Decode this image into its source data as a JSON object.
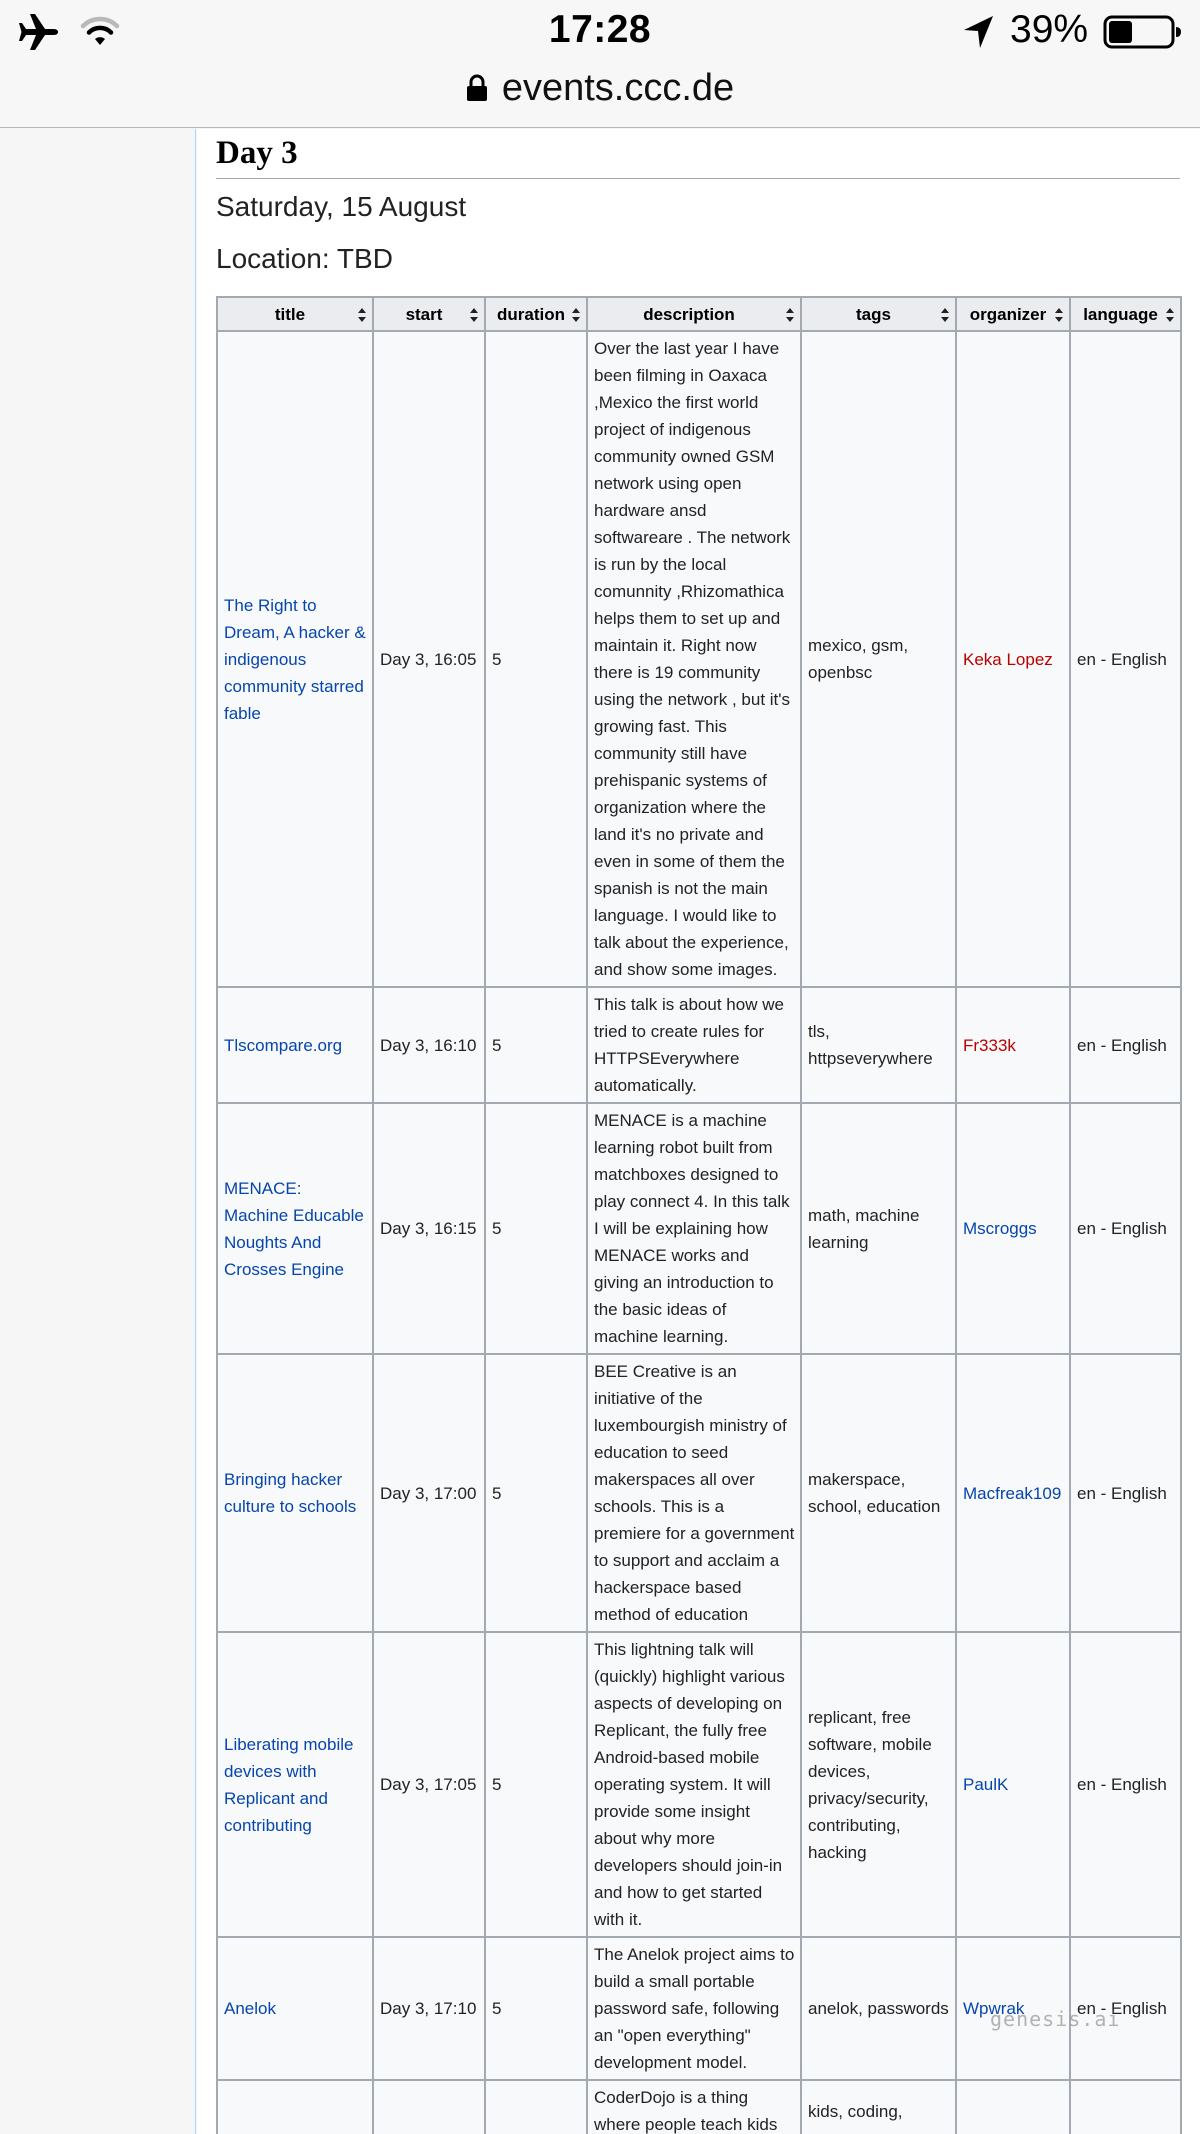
{
  "status_bar": {
    "time": "17:28",
    "battery_percent": "39%",
    "battery_level": 0.39,
    "url": "events.ccc.de"
  },
  "page": {
    "day_heading": "Day 3",
    "date": "Saturday, 15 August",
    "location": "Location: TBD"
  },
  "table": {
    "headers": [
      "title",
      "start",
      "duration",
      "description",
      "tags",
      "organizer",
      "language"
    ],
    "rows": [
      {
        "title": "The Right to Dream, A hacker & indigenous community starred fable",
        "start": "Day 3, 16:05",
        "duration": "5",
        "description": "Over the last year I have been filming in Oaxaca ,Mexico the first world project of indigenous community owned GSM network using open hardware ansd softwareare . The network is run by the local comunnity ,Rhizomathica helps them to set up and maintain it. Right now there is 19 community using the network , but it's growing fast. This community still have prehispanic systems of organization where the land it's no private and even in some of them the spanish is not the main language. I would like to talk about the experience, and show some images.",
        "tags": "mexico, gsm, openbsc",
        "organizer": "Keka Lopez",
        "organizer_missing_page": true,
        "language": "en - English"
      },
      {
        "title": "Tlscompare.org",
        "start": "Day 3, 16:10",
        "duration": "5",
        "description": "This talk is about how we tried to create rules for HTTPSEverywhere automatically.",
        "tags": "tls, httpseverywhere",
        "organizer": "Fr333k",
        "organizer_missing_page": true,
        "language": "en - English"
      },
      {
        "title": "MENACE: Machine Educable Noughts And Crosses Engine",
        "start": "Day 3, 16:15",
        "duration": "5",
        "description": "MENACE is a machine learning robot built from matchboxes designed to play connect 4. In this talk I will be explaining how MENACE works and giving an introduction to the basic ideas of machine learning.",
        "tags": "math, machine learning",
        "organizer": "Mscroggs",
        "organizer_missing_page": false,
        "language": "en - English"
      },
      {
        "title": "Bringing hacker culture to schools",
        "start": "Day 3, 17:00",
        "duration": "5",
        "description": "BEE Creative is an initiative of the luxembourgish ministry of education to seed makerspaces all over schools. This is a premiere for a government to support and acclaim a hackerspace based method of education",
        "tags": "makerspace, school, education",
        "organizer": "Macfreak109",
        "organizer_missing_page": false,
        "language": "en - English"
      },
      {
        "title": "Liberating mobile devices with Replicant and contributing",
        "start": "Day 3, 17:05",
        "duration": "5",
        "description": "This lightning talk will (quickly) highlight various aspects of developing on Replicant, the fully free Android-based mobile operating system. It will provide some insight about why more developers should join-in and how to get started with it.",
        "tags": "replicant, free software, mobile devices, privacy/security, contributing, hacking",
        "organizer": "PaulK",
        "organizer_missing_page": false,
        "language": "en - English"
      },
      {
        "title": "Anelok",
        "start": "Day 3, 17:10",
        "duration": "5",
        "description": "The Anelok project aims to build a small portable password safe, following an \"open everything\" development model.",
        "tags": "anelok, passwords",
        "organizer": "Wpwrak",
        "organizer_missing_page": false,
        "language": "en - English"
      },
      {
        "title": "",
        "start": "",
        "duration": "",
        "description": "CoderDojo is a thing where people teach kids",
        "tags": "kids, coding,",
        "organizer": "",
        "organizer_missing_page": false,
        "language": ""
      }
    ]
  },
  "watermark": "genesis.ai"
}
